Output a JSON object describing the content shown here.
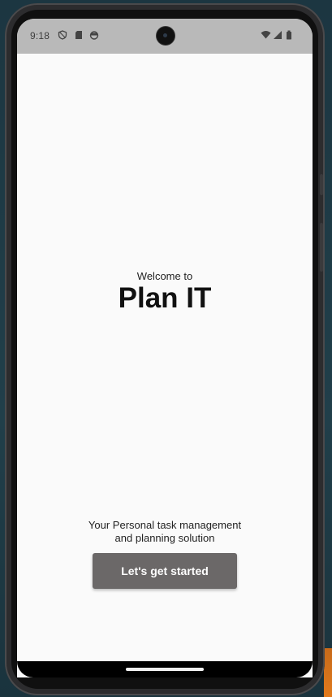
{
  "status_bar": {
    "time": "9:18",
    "left_icons": [
      "shield-icon",
      "sd-card-icon",
      "android-icon"
    ],
    "right_icons": [
      "wifi-icon",
      "cellular-signal-icon",
      "battery-icon"
    ]
  },
  "welcome_screen": {
    "welcome_text": "Welcome to",
    "app_title": "Plan IT",
    "tagline_line1": "Your Personal task management",
    "tagline_line2": "and planning solution",
    "cta_label": "Let's get started"
  },
  "colors": {
    "background": "#fafafa",
    "status_bar": "#b9b9b9",
    "button": "#6b6868",
    "button_text": "#ffffff"
  }
}
